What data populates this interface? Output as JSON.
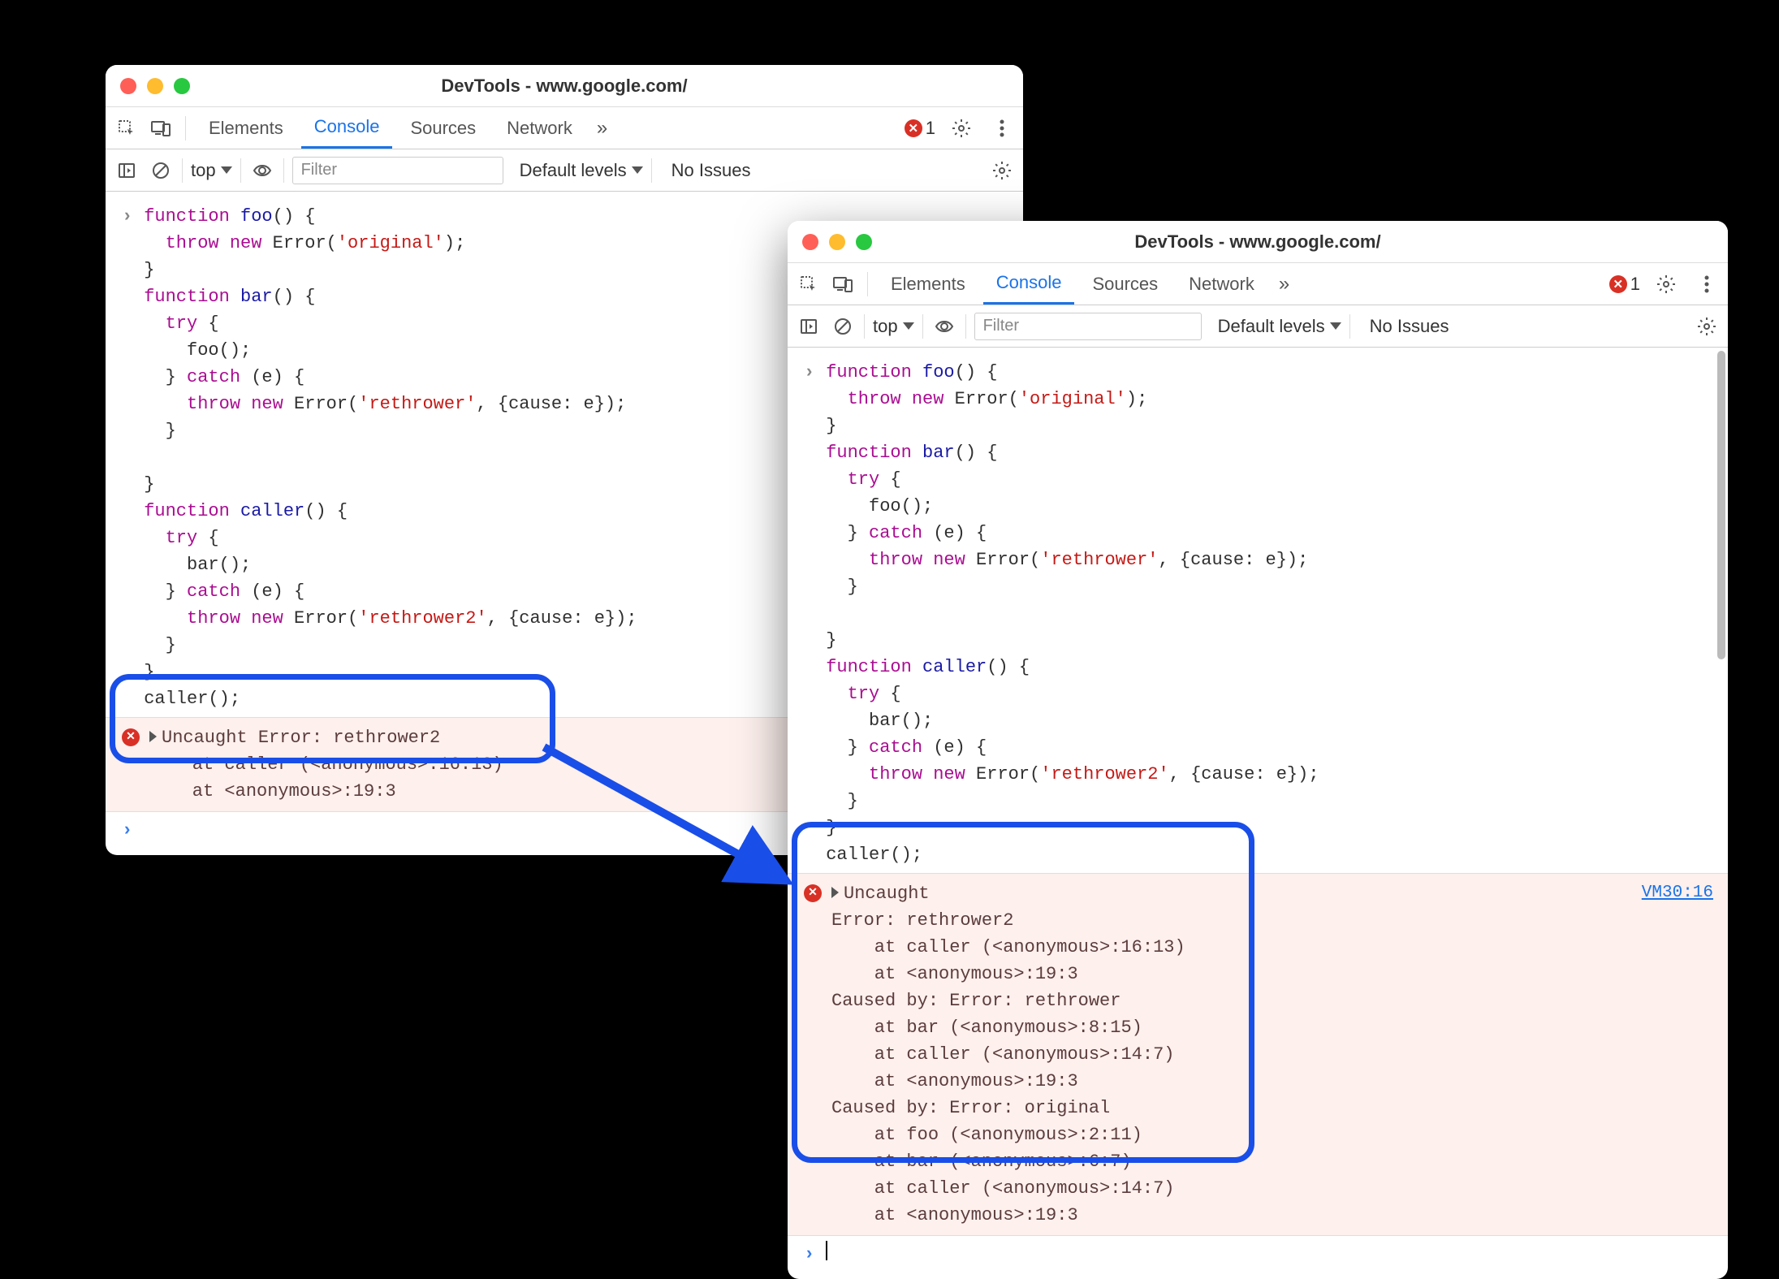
{
  "windows": [
    {
      "title": "DevTools - www.google.com/",
      "tabs": [
        "Elements",
        "Console",
        "Sources",
        "Network"
      ],
      "active_tab": "Console",
      "error_count": "1",
      "context": "top",
      "filter_placeholder": "Filter",
      "levels_label": "Default levels",
      "issues_label": "No Issues",
      "code_lines": [
        [
          {
            "t": "kw",
            "v": "function"
          },
          {
            "t": "",
            "v": " "
          },
          {
            "t": "fn",
            "v": "foo"
          },
          {
            "t": "",
            "v": "() {"
          }
        ],
        [
          {
            "t": "",
            "v": "  "
          },
          {
            "t": "kw",
            "v": "throw"
          },
          {
            "t": "",
            "v": " "
          },
          {
            "t": "kw",
            "v": "new"
          },
          {
            "t": "",
            "v": " Error("
          },
          {
            "t": "str",
            "v": "'original'"
          },
          {
            "t": "",
            "v": ");"
          }
        ],
        [
          {
            "t": "",
            "v": "}"
          }
        ],
        [
          {
            "t": "kw",
            "v": "function"
          },
          {
            "t": "",
            "v": " "
          },
          {
            "t": "fn",
            "v": "bar"
          },
          {
            "t": "",
            "v": "() {"
          }
        ],
        [
          {
            "t": "",
            "v": "  "
          },
          {
            "t": "kw",
            "v": "try"
          },
          {
            "t": "",
            "v": " {"
          }
        ],
        [
          {
            "t": "",
            "v": "    foo();"
          }
        ],
        [
          {
            "t": "",
            "v": "  } "
          },
          {
            "t": "kw",
            "v": "catch"
          },
          {
            "t": "",
            "v": " (e) {"
          }
        ],
        [
          {
            "t": "",
            "v": "    "
          },
          {
            "t": "kw",
            "v": "throw"
          },
          {
            "t": "",
            "v": " "
          },
          {
            "t": "kw",
            "v": "new"
          },
          {
            "t": "",
            "v": " Error("
          },
          {
            "t": "str",
            "v": "'rethrower'"
          },
          {
            "t": "",
            "v": ", {cause: e});"
          }
        ],
        [
          {
            "t": "",
            "v": "  }"
          }
        ],
        [
          {
            "t": "",
            "v": ""
          }
        ],
        [
          {
            "t": "",
            "v": "}"
          }
        ],
        [
          {
            "t": "kw",
            "v": "function"
          },
          {
            "t": "",
            "v": " "
          },
          {
            "t": "fn",
            "v": "caller"
          },
          {
            "t": "",
            "v": "() {"
          }
        ],
        [
          {
            "t": "",
            "v": "  "
          },
          {
            "t": "kw",
            "v": "try"
          },
          {
            "t": "",
            "v": " {"
          }
        ],
        [
          {
            "t": "",
            "v": "    bar();"
          }
        ],
        [
          {
            "t": "",
            "v": "  } "
          },
          {
            "t": "kw",
            "v": "catch"
          },
          {
            "t": "",
            "v": " (e) {"
          }
        ],
        [
          {
            "t": "",
            "v": "    "
          },
          {
            "t": "kw",
            "v": "throw"
          },
          {
            "t": "",
            "v": " "
          },
          {
            "t": "kw",
            "v": "new"
          },
          {
            "t": "",
            "v": " Error("
          },
          {
            "t": "str",
            "v": "'rethrower2'"
          },
          {
            "t": "",
            "v": ", {cause: e});"
          }
        ],
        [
          {
            "t": "",
            "v": "  }"
          }
        ],
        [
          {
            "t": "",
            "v": "}"
          }
        ],
        [
          {
            "t": "",
            "v": "caller();"
          }
        ]
      ],
      "error_text": "Uncaught Error: rethrower2\n    at caller (<anonymous>:16:13)\n    at <anonymous>:19:3"
    },
    {
      "title": "DevTools - www.google.com/",
      "tabs": [
        "Elements",
        "Console",
        "Sources",
        "Network"
      ],
      "active_tab": "Console",
      "error_count": "1",
      "context": "top",
      "filter_placeholder": "Filter",
      "levels_label": "Default levels",
      "issues_label": "No Issues",
      "source_link": "VM30:16",
      "error_text": "Uncaught \nError: rethrower2\n    at caller (<anonymous>:16:13)\n    at <anonymous>:19:3\nCaused by: Error: rethrower\n    at bar (<anonymous>:8:15)\n    at caller (<anonymous>:14:7)\n    at <anonymous>:19:3\nCaused by: Error: original\n    at foo (<anonymous>:2:11)\n    at bar (<anonymous>:6:7)\n    at caller (<anonymous>:14:7)\n    at <anonymous>:19:3"
    }
  ]
}
